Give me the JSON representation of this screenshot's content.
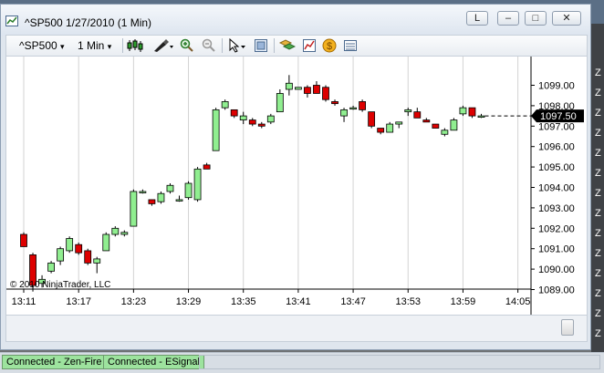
{
  "window": {
    "title": "^SP500  1/27/2010 (1 Min)",
    "controls": {
      "link": "L",
      "minimize": "–",
      "restore": "□",
      "close": "✕"
    }
  },
  "toolbar": {
    "instrument": "^SP500",
    "interval": "1 Min",
    "dropdown_glyph": "▾"
  },
  "background": {
    "right_edge_letters": [
      "Z",
      "Z",
      "Z",
      "Z",
      "Z",
      "Z",
      "Z",
      "Z",
      "Z",
      "Z",
      "Z",
      "Z",
      "Z",
      "Z"
    ]
  },
  "chart_data": {
    "type": "candlestick",
    "watermark": "© 2010 NinjaTrader, LLC",
    "last_price": "1097.50",
    "y_ticks": [
      "1099.00",
      "1098.00",
      "1097.00",
      "1096.00",
      "1095.00",
      "1094.00",
      "1093.00",
      "1092.00",
      "1091.00",
      "1090.00",
      "1089.00"
    ],
    "y_tick_values": [
      1099,
      1098,
      1097,
      1096,
      1095,
      1094,
      1093,
      1092,
      1091,
      1090,
      1089
    ],
    "x_ticks": [
      "13:11",
      "13:17",
      "13:23",
      "13:29",
      "13:35",
      "13:41",
      "13:47",
      "13:53",
      "13:59",
      "14:05"
    ],
    "grid": "vertical",
    "colors": {
      "up": "#90ee90",
      "down": "#dd0000",
      "outline": "#000000",
      "last_price_bg": "#000000",
      "grid": "#d3d3d3"
    },
    "bars": [
      {
        "t": "13:11",
        "o": 1091.7,
        "h": 1091.8,
        "l": 1091.1,
        "c": 1091.1
      },
      {
        "t": "13:12",
        "o": 1090.7,
        "h": 1090.8,
        "l": 1088.9,
        "c": 1089.2
      },
      {
        "t": "13:13",
        "o": 1089.3,
        "h": 1089.7,
        "l": 1089.1,
        "c": 1089.5
      },
      {
        "t": "13:14",
        "o": 1089.9,
        "h": 1090.4,
        "l": 1089.8,
        "c": 1090.3
      },
      {
        "t": "13:15",
        "o": 1090.4,
        "h": 1091.1,
        "l": 1090.2,
        "c": 1091.0
      },
      {
        "t": "13:16",
        "o": 1090.9,
        "h": 1091.6,
        "l": 1090.8,
        "c": 1091.5
      },
      {
        "t": "13:17",
        "o": 1091.2,
        "h": 1091.3,
        "l": 1090.7,
        "c": 1090.8
      },
      {
        "t": "13:18",
        "o": 1090.9,
        "h": 1091.0,
        "l": 1090.2,
        "c": 1090.3
      },
      {
        "t": "13:19",
        "o": 1090.3,
        "h": 1090.6,
        "l": 1089.8,
        "c": 1090.5
      },
      {
        "t": "13:20",
        "o": 1090.9,
        "h": 1091.8,
        "l": 1090.9,
        "c": 1091.7
      },
      {
        "t": "13:21",
        "o": 1091.7,
        "h": 1092.1,
        "l": 1091.6,
        "c": 1092.0
      },
      {
        "t": "13:22",
        "o": 1091.7,
        "h": 1091.9,
        "l": 1091.6,
        "c": 1091.8
      },
      {
        "t": "13:23",
        "o": 1092.1,
        "h": 1093.9,
        "l": 1092.1,
        "c": 1093.8
      },
      {
        "t": "13:24",
        "o": 1093.8,
        "h": 1093.9,
        "l": 1093.7,
        "c": 1093.8
      },
      {
        "t": "13:25",
        "o": 1093.4,
        "h": 1093.4,
        "l": 1093.1,
        "c": 1093.2
      },
      {
        "t": "13:26",
        "o": 1093.3,
        "h": 1093.8,
        "l": 1093.2,
        "c": 1093.7
      },
      {
        "t": "13:27",
        "o": 1093.8,
        "h": 1094.2,
        "l": 1093.7,
        "c": 1094.1
      },
      {
        "t": "13:28",
        "o": 1093.4,
        "h": 1093.6,
        "l": 1093.3,
        "c": 1093.4
      },
      {
        "t": "13:29",
        "o": 1093.5,
        "h": 1094.3,
        "l": 1093.4,
        "c": 1094.2
      },
      {
        "t": "13:30",
        "o": 1093.4,
        "h": 1095.0,
        "l": 1093.3,
        "c": 1094.9
      },
      {
        "t": "13:31",
        "o": 1095.1,
        "h": 1095.2,
        "l": 1094.9,
        "c": 1094.9
      },
      {
        "t": "13:32",
        "o": 1095.8,
        "h": 1097.9,
        "l": 1095.8,
        "c": 1097.8
      },
      {
        "t": "13:33",
        "o": 1097.9,
        "h": 1098.3,
        "l": 1097.8,
        "c": 1098.2
      },
      {
        "t": "13:34",
        "o": 1097.8,
        "h": 1097.8,
        "l": 1097.4,
        "c": 1097.5
      },
      {
        "t": "13:35",
        "o": 1097.3,
        "h": 1097.7,
        "l": 1097.1,
        "c": 1097.5
      },
      {
        "t": "13:36",
        "o": 1097.3,
        "h": 1097.4,
        "l": 1097.0,
        "c": 1097.1
      },
      {
        "t": "13:37",
        "o": 1097.1,
        "h": 1097.2,
        "l": 1096.9,
        "c": 1097.0
      },
      {
        "t": "13:38",
        "o": 1097.2,
        "h": 1097.6,
        "l": 1097.1,
        "c": 1097.5
      },
      {
        "t": "13:39",
        "o": 1097.7,
        "h": 1098.8,
        "l": 1097.7,
        "c": 1098.6
      },
      {
        "t": "13:40",
        "o": 1098.8,
        "h": 1099.5,
        "l": 1098.5,
        "c": 1099.1
      },
      {
        "t": "13:41",
        "o": 1098.8,
        "h": 1098.9,
        "l": 1098.8,
        "c": 1098.9
      },
      {
        "t": "13:42",
        "o": 1098.9,
        "h": 1099.0,
        "l": 1098.4,
        "c": 1098.6
      },
      {
        "t": "13:43",
        "o": 1099.0,
        "h": 1099.2,
        "l": 1098.6,
        "c": 1098.6
      },
      {
        "t": "13:44",
        "o": 1098.9,
        "h": 1099.0,
        "l": 1098.2,
        "c": 1098.3
      },
      {
        "t": "13:45",
        "o": 1098.2,
        "h": 1098.3,
        "l": 1098.0,
        "c": 1098.1
      },
      {
        "t": "13:46",
        "o": 1097.5,
        "h": 1097.9,
        "l": 1097.2,
        "c": 1097.8
      },
      {
        "t": "13:47",
        "o": 1097.9,
        "h": 1098.0,
        "l": 1097.8,
        "c": 1097.9
      },
      {
        "t": "13:48",
        "o": 1098.2,
        "h": 1098.3,
        "l": 1097.7,
        "c": 1097.8
      },
      {
        "t": "13:49",
        "o": 1097.7,
        "h": 1097.7,
        "l": 1096.9,
        "c": 1097.0
      },
      {
        "t": "13:50",
        "o": 1096.9,
        "h": 1096.9,
        "l": 1096.6,
        "c": 1096.7
      },
      {
        "t": "13:51",
        "o": 1096.7,
        "h": 1097.2,
        "l": 1096.7,
        "c": 1097.1
      },
      {
        "t": "13:52",
        "o": 1097.1,
        "h": 1097.2,
        "l": 1096.9,
        "c": 1097.2
      },
      {
        "t": "13:53",
        "o": 1097.7,
        "h": 1097.9,
        "l": 1097.5,
        "c": 1097.8
      },
      {
        "t": "13:54",
        "o": 1097.7,
        "h": 1097.9,
        "l": 1097.4,
        "c": 1097.4
      },
      {
        "t": "13:55",
        "o": 1097.3,
        "h": 1097.4,
        "l": 1097.2,
        "c": 1097.2
      },
      {
        "t": "13:56",
        "o": 1097.1,
        "h": 1097.1,
        "l": 1096.9,
        "c": 1096.9
      },
      {
        "t": "13:57",
        "o": 1096.6,
        "h": 1096.9,
        "l": 1096.5,
        "c": 1096.8
      },
      {
        "t": "13:58",
        "o": 1096.8,
        "h": 1097.4,
        "l": 1096.8,
        "c": 1097.3
      },
      {
        "t": "13:59",
        "o": 1097.6,
        "h": 1098.0,
        "l": 1097.5,
        "c": 1097.9
      },
      {
        "t": "14:00",
        "o": 1097.9,
        "h": 1097.9,
        "l": 1097.4,
        "c": 1097.5
      },
      {
        "t": "14:01",
        "o": 1097.5,
        "h": 1097.6,
        "l": 1097.4,
        "c": 1097.5
      }
    ]
  },
  "status": {
    "connection_1": "Connected - Zen-Fire",
    "connection_2": "Connected - ESignal"
  }
}
